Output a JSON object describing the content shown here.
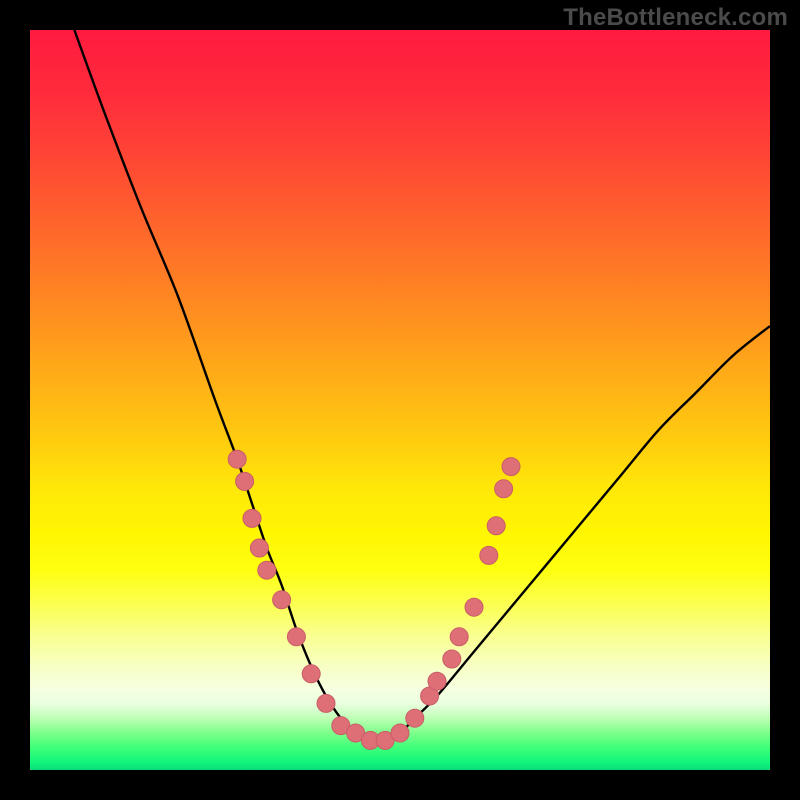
{
  "watermark": "TheBottleneck.com",
  "colors": {
    "background": "#000000",
    "curve_stroke": "#000000",
    "marker_fill": "#de6f77",
    "marker_stroke": "#c95d67"
  },
  "chart_data": {
    "type": "line",
    "title": "",
    "xlabel": "",
    "ylabel": "",
    "xlim": [
      0,
      100
    ],
    "ylim": [
      0,
      100
    ],
    "series": [
      {
        "name": "bottleneck-curve",
        "x": [
          6,
          10,
          15,
          20,
          25,
          28,
          30,
          32,
          34,
          36,
          38,
          40,
          42,
          44,
          46,
          48,
          50,
          52,
          55,
          60,
          65,
          70,
          75,
          80,
          85,
          90,
          95,
          100
        ],
        "y": [
          100,
          89,
          76,
          64,
          50,
          42,
          36,
          30,
          25,
          19,
          14,
          10,
          7,
          5,
          4,
          4,
          5,
          7,
          10,
          16,
          22,
          28,
          34,
          40,
          46,
          51,
          56,
          60
        ]
      }
    ],
    "markers": [
      {
        "x": 28,
        "y": 42
      },
      {
        "x": 29,
        "y": 39
      },
      {
        "x": 30,
        "y": 34
      },
      {
        "x": 31,
        "y": 30
      },
      {
        "x": 32,
        "y": 27
      },
      {
        "x": 34,
        "y": 23
      },
      {
        "x": 36,
        "y": 18
      },
      {
        "x": 38,
        "y": 13
      },
      {
        "x": 40,
        "y": 9
      },
      {
        "x": 42,
        "y": 6
      },
      {
        "x": 44,
        "y": 5
      },
      {
        "x": 46,
        "y": 4
      },
      {
        "x": 48,
        "y": 4
      },
      {
        "x": 50,
        "y": 5
      },
      {
        "x": 52,
        "y": 7
      },
      {
        "x": 54,
        "y": 10
      },
      {
        "x": 55,
        "y": 12
      },
      {
        "x": 57,
        "y": 15
      },
      {
        "x": 58,
        "y": 18
      },
      {
        "x": 60,
        "y": 22
      },
      {
        "x": 62,
        "y": 29
      },
      {
        "x": 63,
        "y": 33
      },
      {
        "x": 64,
        "y": 38
      },
      {
        "x": 65,
        "y": 41
      }
    ]
  }
}
